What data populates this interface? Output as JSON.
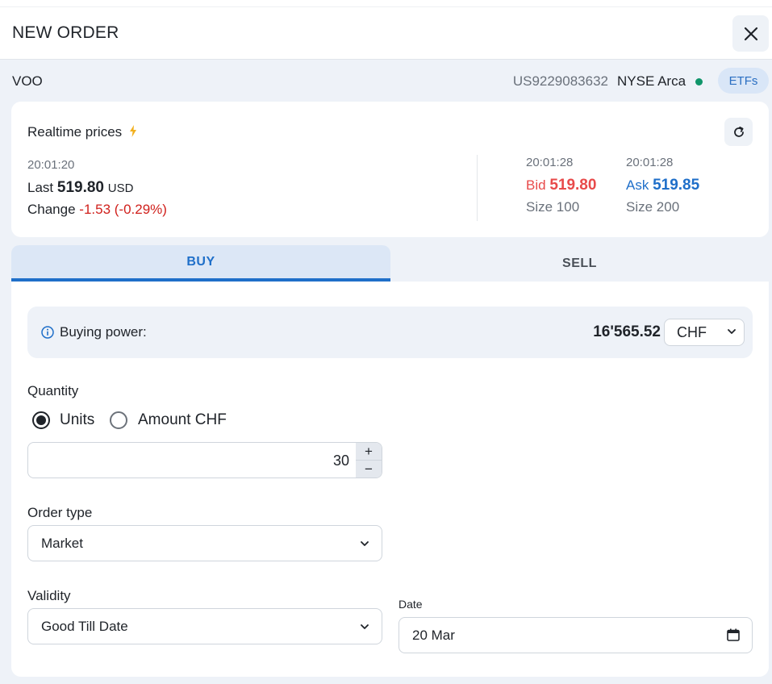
{
  "header": {
    "title": "NEW ORDER",
    "close_icon": "close-icon"
  },
  "instrument": {
    "symbol": "VOO",
    "isin": "US9229083632",
    "exchange": "NYSE Arca",
    "status_color": "#10956a",
    "asset_class": "ETFs"
  },
  "realtime": {
    "title": "Realtime prices",
    "last_time": "20:01:20",
    "last_label": "Last",
    "last_value": "519.80",
    "last_currency": "USD",
    "change_label": "Change",
    "change_value": "-1.53 (-0.29%)",
    "bid_time": "20:01:28",
    "bid_label": "Bid",
    "bid_value": "519.80",
    "bid_size": "Size 100",
    "ask_time": "20:01:28",
    "ask_label": "Ask",
    "ask_value": "519.85",
    "ask_size": "Size 200",
    "colors": {
      "bid": "#e84a4a",
      "ask": "#1f6fc9",
      "negative": "#d0201c"
    }
  },
  "tabs": [
    {
      "label": "BUY",
      "active": true
    },
    {
      "label": "SELL",
      "active": false
    }
  ],
  "buying_power": {
    "label": "Buying power:",
    "value": "16'565.52",
    "currency": "CHF"
  },
  "quantity": {
    "label": "Quantity",
    "mode_units": "Units",
    "mode_amount": "Amount CHF",
    "selected_mode": "Units",
    "value": "30",
    "increment": "+",
    "decrement": "−"
  },
  "order_type": {
    "label": "Order type",
    "value": "Market"
  },
  "validity": {
    "label": "Validity",
    "value": "Good Till Date"
  },
  "date": {
    "label": "Date",
    "value": "20 Mar"
  },
  "accent_color": "#1f6fc9"
}
